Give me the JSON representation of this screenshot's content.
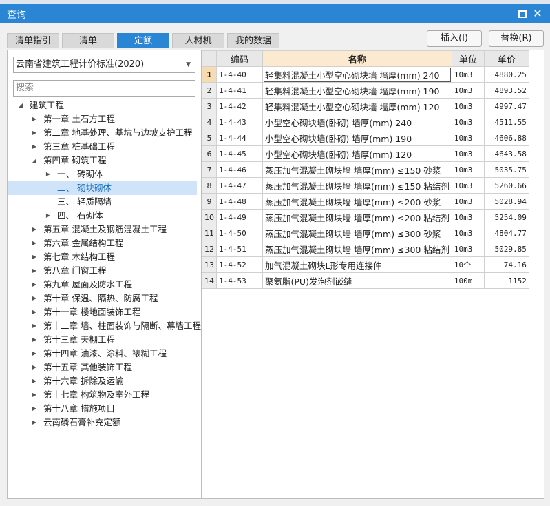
{
  "window": {
    "title": "查询"
  },
  "tabs": [
    {
      "label": "清单指引"
    },
    {
      "label": "清单"
    },
    {
      "label": "定额"
    },
    {
      "label": "人材机"
    },
    {
      "label": "我的数据"
    }
  ],
  "buttons": {
    "insert": "插入(I)",
    "replace": "替换(R)"
  },
  "standard_select": {
    "value": "云南省建筑工程计价标准(2020)"
  },
  "search": {
    "placeholder": "搜索"
  },
  "tree": [
    {
      "label": "建筑工程",
      "level": 0,
      "state": "expanded"
    },
    {
      "label": "第一章 土石方工程",
      "level": 1,
      "state": "collapsed"
    },
    {
      "label": "第二章 地基处理、基坑与边坡支护工程",
      "level": 1,
      "state": "collapsed"
    },
    {
      "label": "第三章 桩基础工程",
      "level": 1,
      "state": "collapsed"
    },
    {
      "label": "第四章 砌筑工程",
      "level": 1,
      "state": "expanded"
    },
    {
      "label": "一、  砖砌体",
      "level": 2,
      "state": "collapsed"
    },
    {
      "label": "二、  砌块砌体",
      "level": 2,
      "state": "leaf",
      "selected": true
    },
    {
      "label": "三、  轻质隔墙",
      "level": 2,
      "state": "leaf"
    },
    {
      "label": "四、  石砌体",
      "level": 2,
      "state": "collapsed"
    },
    {
      "label": "第五章 混凝土及钢筋混凝土工程",
      "level": 1,
      "state": "collapsed"
    },
    {
      "label": "第六章 金属结构工程",
      "level": 1,
      "state": "collapsed"
    },
    {
      "label": "第七章 木结构工程",
      "level": 1,
      "state": "collapsed"
    },
    {
      "label": "第八章 门窗工程",
      "level": 1,
      "state": "collapsed"
    },
    {
      "label": "第九章 屋面及防水工程",
      "level": 1,
      "state": "collapsed"
    },
    {
      "label": "第十章 保温、隔热、防腐工程",
      "level": 1,
      "state": "collapsed"
    },
    {
      "label": "第十一章 楼地面装饰工程",
      "level": 1,
      "state": "collapsed"
    },
    {
      "label": "第十二章 墙、柱面装饰与隔断、幕墙工程",
      "level": 1,
      "state": "collapsed"
    },
    {
      "label": "第十三章 天棚工程",
      "level": 1,
      "state": "collapsed"
    },
    {
      "label": "第十四章 油漆、涂料、裱糊工程",
      "level": 1,
      "state": "collapsed"
    },
    {
      "label": "第十五章 其他装饰工程",
      "level": 1,
      "state": "collapsed"
    },
    {
      "label": "第十六章 拆除及运输",
      "level": 1,
      "state": "collapsed"
    },
    {
      "label": "第十七章 构筑物及室外工程",
      "level": 1,
      "state": "collapsed"
    },
    {
      "label": "第十八章 措施项目",
      "level": 1,
      "state": "collapsed"
    },
    {
      "label": "云南磷石膏补充定额",
      "level": 1,
      "state": "collapsed"
    }
  ],
  "table": {
    "headers": {
      "idx": "",
      "code": "编码",
      "name": "名称",
      "unit": "单位",
      "price": "单价"
    },
    "rows": [
      {
        "idx": "1",
        "code": "1-4-40",
        "name": "轻集料混凝土小型空心砌块墙 墙厚(mm) 240",
        "unit": "10m3",
        "price": "4880.25"
      },
      {
        "idx": "2",
        "code": "1-4-41",
        "name": "轻集料混凝土小型空心砌块墙 墙厚(mm) 190",
        "unit": "10m3",
        "price": "4893.52"
      },
      {
        "idx": "3",
        "code": "1-4-42",
        "name": "轻集料混凝土小型空心砌块墙 墙厚(mm) 120",
        "unit": "10m3",
        "price": "4997.47"
      },
      {
        "idx": "4",
        "code": "1-4-43",
        "name": "小型空心砌块墙(卧砌) 墙厚(mm) 240",
        "unit": "10m3",
        "price": "4511.55"
      },
      {
        "idx": "5",
        "code": "1-4-44",
        "name": "小型空心砌块墙(卧砌) 墙厚(mm) 190",
        "unit": "10m3",
        "price": "4606.88"
      },
      {
        "idx": "6",
        "code": "1-4-45",
        "name": "小型空心砌块墙(卧砌) 墙厚(mm) 120",
        "unit": "10m3",
        "price": "4643.58"
      },
      {
        "idx": "7",
        "code": "1-4-46",
        "name": "蒸压加气混凝土砌块墙 墙厚(mm) ≤150 砂浆",
        "unit": "10m3",
        "price": "5035.75"
      },
      {
        "idx": "8",
        "code": "1-4-47",
        "name": "蒸压加气混凝土砌块墙 墙厚(mm) ≤150 粘结剂",
        "unit": "10m3",
        "price": "5260.66"
      },
      {
        "idx": "9",
        "code": "1-4-48",
        "name": "蒸压加气混凝土砌块墙 墙厚(mm) ≤200 砂浆",
        "unit": "10m3",
        "price": "5028.94"
      },
      {
        "idx": "10",
        "code": "1-4-49",
        "name": "蒸压加气混凝土砌块墙 墙厚(mm) ≤200 粘结剂",
        "unit": "10m3",
        "price": "5254.09"
      },
      {
        "idx": "11",
        "code": "1-4-50",
        "name": "蒸压加气混凝土砌块墙 墙厚(mm) ≤300 砂浆",
        "unit": "10m3",
        "price": "4804.77"
      },
      {
        "idx": "12",
        "code": "1-4-51",
        "name": "蒸压加气混凝土砌块墙 墙厚(mm) ≤300 粘结剂",
        "unit": "10m3",
        "price": "5029.85"
      },
      {
        "idx": "13",
        "code": "1-4-52",
        "name": "加气混凝土砌块L形专用连接件",
        "unit": "10个",
        "price": "74.16"
      },
      {
        "idx": "14",
        "code": "1-4-53",
        "name": "聚氨脂(PU)发泡剂嵌缝",
        "unit": "100m",
        "price": "1152"
      }
    ]
  },
  "colors": {
    "accent": "#2a86d4",
    "selected_bg": "#cfe4f8",
    "header_name_bg": "#fbe9d0",
    "first_row_idx_bg": "#f6dcb0"
  }
}
